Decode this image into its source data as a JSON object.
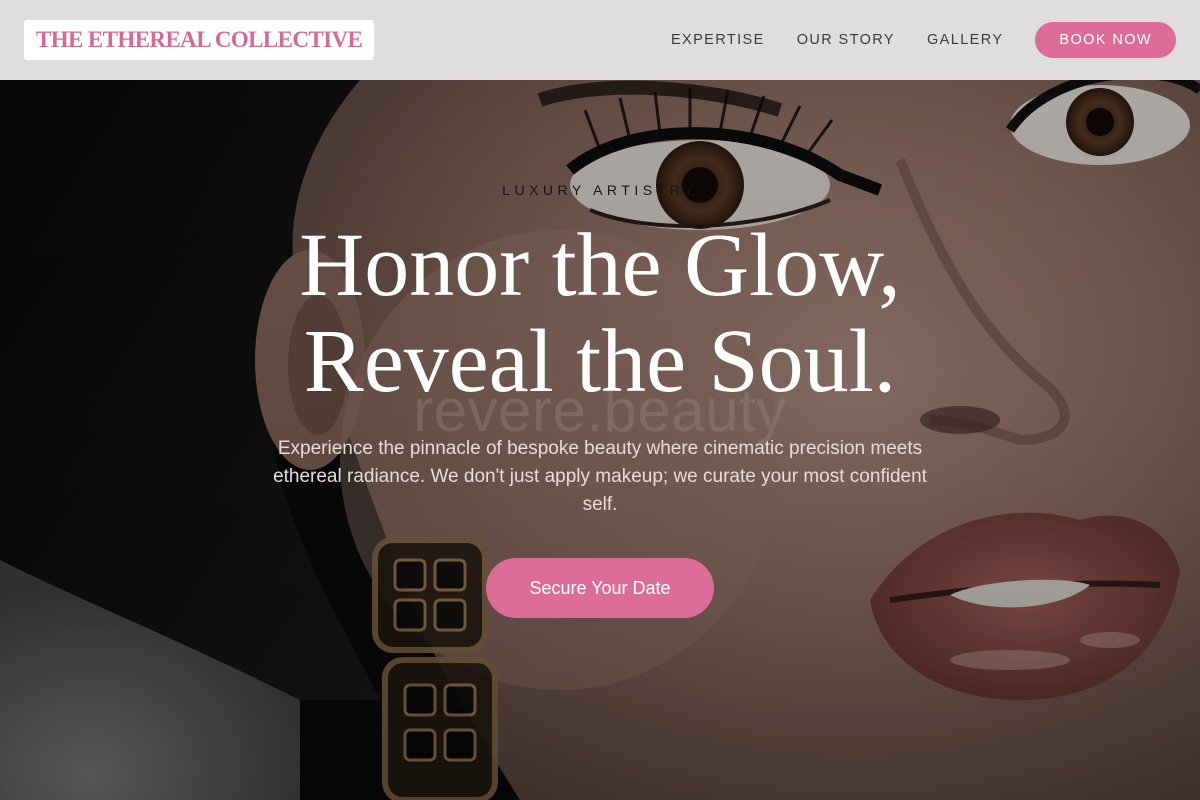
{
  "header": {
    "logo_text": "THE ETHEREAL COLLECTIVE",
    "nav": {
      "expertise": "EXPERTISE",
      "our_story": "OUR STORY",
      "gallery": "GALLERY"
    },
    "book_label": "BOOK NOW"
  },
  "hero": {
    "eyebrow": "LUXURY ARTISTRY",
    "headline_line1": "Honor the Glow,",
    "headline_line2": "Reveal the Soul.",
    "watermark": "revere.beauty",
    "description": "Experience the pinnacle of bespoke beauty where cinematic precision meets ethereal radiance. We don't just apply makeup; we curate your most confident self.",
    "cta_label": "Secure Your Date"
  },
  "colors": {
    "accent": "#dc6c98",
    "logo": "#d56a98",
    "header_bg": "#f0eeee",
    "nav_text": "#3c3c3c"
  }
}
